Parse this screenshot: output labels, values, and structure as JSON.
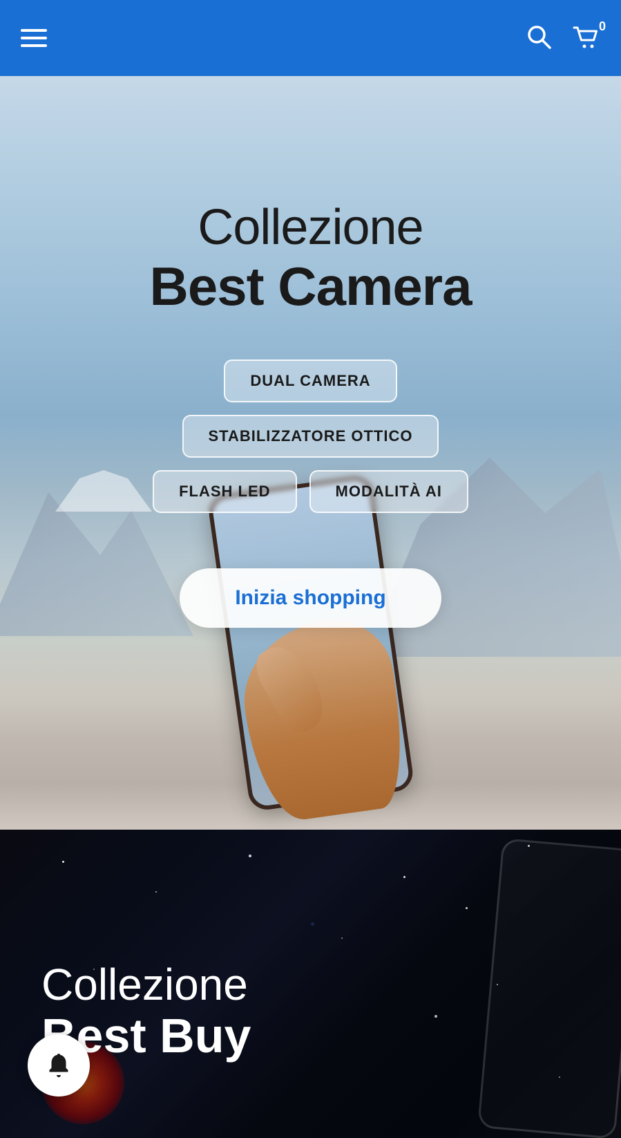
{
  "header": {
    "bg_color": "#1a6fd4",
    "menu_label": "Menu",
    "search_label": "Search",
    "cart_label": "Cart",
    "cart_count": "0"
  },
  "hero": {
    "title_light": "Collezione",
    "title_bold": "Best Camera",
    "badge1": "DUAL CAMERA",
    "badge2": "STABILIZZATORE OTTICO",
    "badge3": "FLASH LED",
    "badge4": "MODALITÀ AI",
    "cta_label": "Inizia shopping"
  },
  "second_section": {
    "title_light": "Collezione",
    "title_bold": "Best Buy"
  },
  "notification": {
    "label": "Notification bell"
  }
}
